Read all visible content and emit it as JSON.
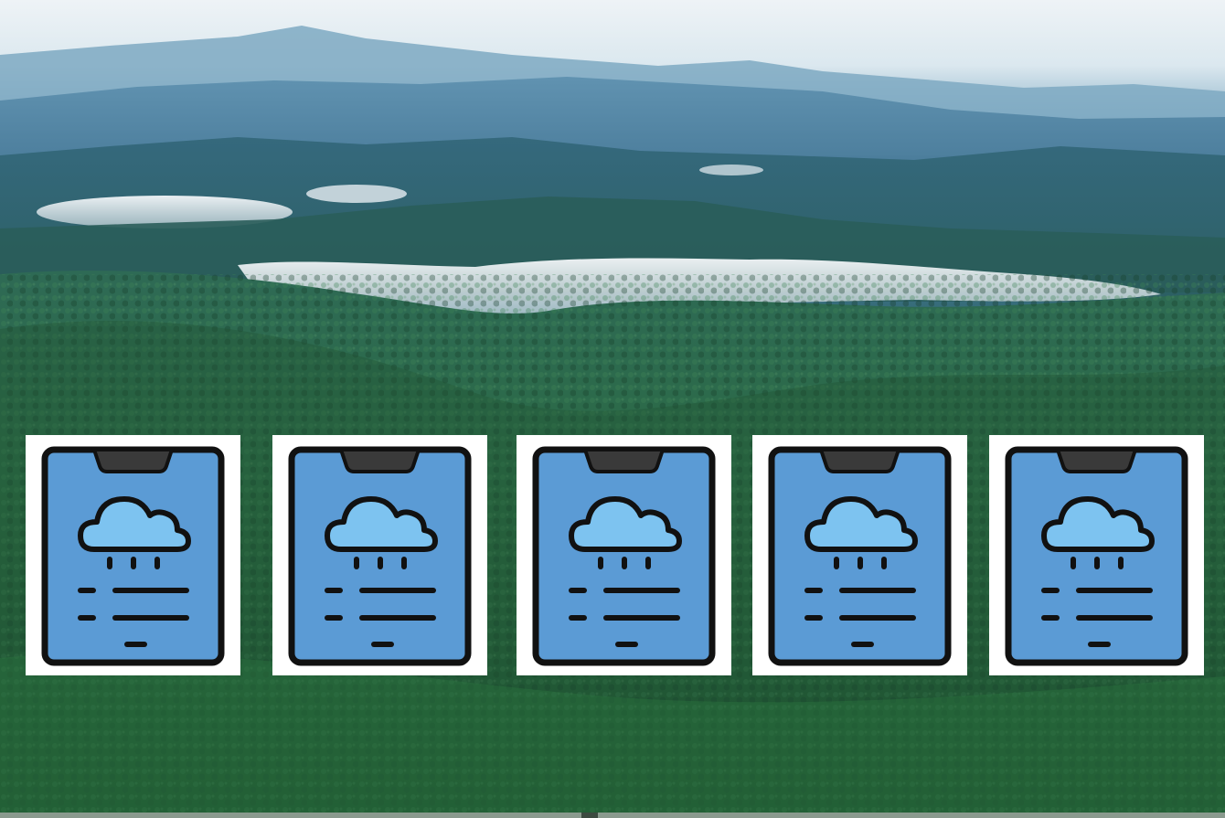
{
  "scene": {
    "background_icon": "misty-forest-mountain-photo",
    "colors": {
      "sky": "#f2f6f8",
      "haze": "#9fc3d6",
      "distant_ridge": "#3f7392",
      "mid_ridge": "#2f6474",
      "forest": "#2c6a45",
      "forest_dark": "#1d4d2e",
      "mist": "#e8eef2"
    }
  },
  "weather_cards": [
    {
      "icon": "weather-app-phone-icon"
    },
    {
      "icon": "weather-app-phone-icon"
    },
    {
      "icon": "weather-app-phone-icon"
    },
    {
      "icon": "weather-app-phone-icon"
    },
    {
      "icon": "weather-app-phone-icon"
    }
  ],
  "icon_colors": {
    "card": "#ffffff",
    "phone_body": "#5b9bd5",
    "outline": "#111111",
    "cloud": "#7dc3f0",
    "notch": "#3a3a3a"
  }
}
